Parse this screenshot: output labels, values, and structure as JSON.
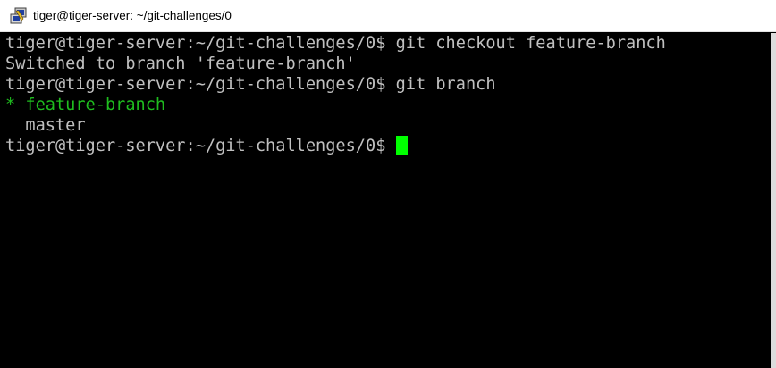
{
  "window": {
    "title": "tiger@tiger-server: ~/git-challenges/0",
    "icon": "putty-icon"
  },
  "terminal": {
    "lines": [
      {
        "prompt": "tiger@tiger-server:~/git-challenges/0$",
        "command": " git checkout feature-branch"
      },
      {
        "output": "Switched to branch 'feature-branch'"
      },
      {
        "prompt": "tiger@tiger-server:~/git-challenges/0$",
        "command": " git branch"
      },
      {
        "marker": "* ",
        "branch": "feature-branch"
      },
      {
        "output": "  master"
      },
      {
        "prompt": "tiger@tiger-server:~/git-challenges/0$",
        "command": " "
      }
    ],
    "colors": {
      "background": "#000000",
      "text": "#c0c0c0",
      "current_branch": "#1fbd1f",
      "cursor": "#00ff00"
    }
  }
}
